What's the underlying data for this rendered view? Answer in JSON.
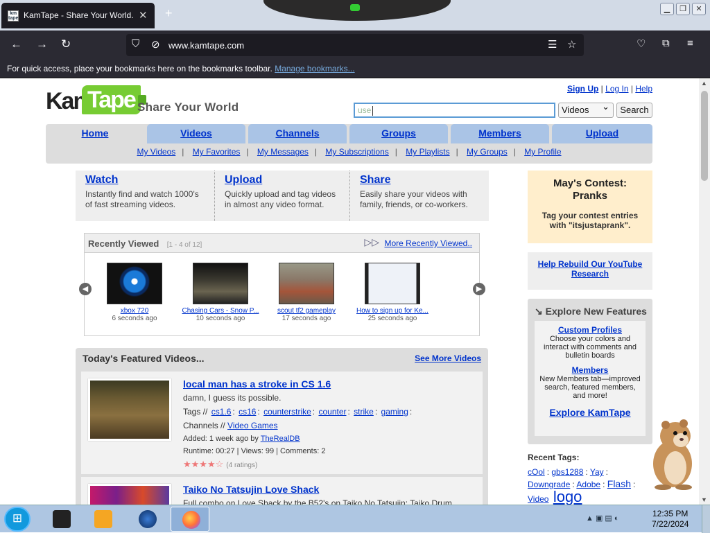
{
  "browser": {
    "tab_title": "KamTape - Share Your World.",
    "tab_favicon": "km tape",
    "url": "www.kamtape.com",
    "bookmarks_text": "For quick access, place your bookmarks here on the bookmarks toolbar.",
    "bookmarks_link": "Manage bookmarks..."
  },
  "header": {
    "logo_kam": "Kam",
    "logo_tape": "Tape",
    "slogan": "Share Your World",
    "signup": "Sign Up",
    "login": "Log In",
    "help": "Help",
    "search_value": "use",
    "search_scope": "Videos",
    "search_button": "Search"
  },
  "nav": {
    "tabs": [
      "Home",
      "Videos",
      "Channels",
      "Groups",
      "Members",
      "Upload"
    ],
    "sub": [
      "My Videos",
      "My Favorites",
      "My Messages",
      "My Subscriptions",
      "My Playlists",
      "My Groups",
      "My Profile"
    ]
  },
  "intro": [
    {
      "title": "Watch",
      "text": "Instantly find and watch 1000's of fast streaming videos."
    },
    {
      "title": "Upload",
      "text": "Quickly upload and tag videos in almost any video format."
    },
    {
      "title": "Share",
      "text": "Easily share your videos with family, friends, or co-workers."
    }
  ],
  "recent": {
    "title": "Recently Viewed",
    "count": "[1 - 4 of 12]",
    "more": "More Recently Viewed..",
    "items": [
      {
        "name": "xbox 720",
        "ago": "6 seconds ago",
        "color": "#1560c0"
      },
      {
        "name": "Chasing Cars - Snow P...",
        "ago": "10 seconds ago",
        "color": "#2b2a24"
      },
      {
        "name": "scout tf2 gameplay",
        "ago": "17 seconds ago",
        "color": "#7b6a5a"
      },
      {
        "name": "How to sign up for Ke...",
        "ago": "25 seconds ago",
        "color": "#dfe6f0"
      }
    ]
  },
  "featured": {
    "title": "Today's Featured Videos...",
    "more": "See More Videos",
    "videos": [
      {
        "title": "local man has a stroke in CS 1.6",
        "desc": "damn, I guess its possible.",
        "tags_label": "Tags //",
        "tags": [
          "cs1.6",
          "cs16",
          "counterstrike",
          "counter",
          "strike",
          "gaming"
        ],
        "channels_label": "Channels //",
        "channel": "Video Games",
        "added": "Added: 1 week ago by",
        "user": "TheRealDB",
        "runtime": "Runtime: 00:27 | Views: 99 | Comments: 2",
        "stars": "★★★★☆",
        "ratings": "(4 ratings)"
      },
      {
        "title": "Taiko No Tatsujin Love Shack",
        "desc": "Full combo on Love Shack by the B52's on Taiko No Tatsujin: Taiko Drum"
      }
    ]
  },
  "sidebar": {
    "contest_title": "May's Contest: Pranks",
    "contest_text": "Tag your contest entries with \"itsjustaprank\".",
    "rebuild": "Help Rebuild Our YouTube Research",
    "explore_title": "Explore New Features",
    "f1_title": "Custom Profiles",
    "f1_text": "Choose your colors and interact with comments and bulletin boards",
    "f2_title": "Members",
    "f2_text": "New Members tab—improved search, featured members, and more!",
    "explore_link": "Explore KamTape",
    "tags_title": "Recent Tags:",
    "tags": [
      "cOol",
      "gbs1288",
      "Yay",
      "Downgrade",
      "Adobe",
      "Flash",
      "Video",
      "logo"
    ]
  },
  "taskbar": {
    "time": "12:35 PM",
    "date": "7/22/2024"
  }
}
